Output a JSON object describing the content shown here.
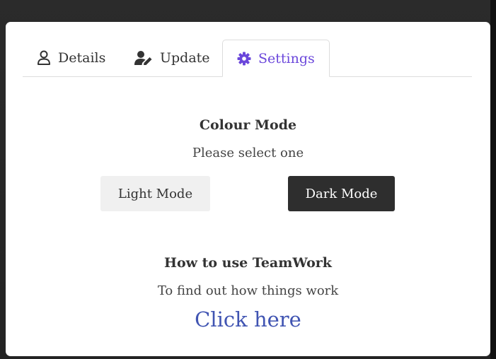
{
  "tabs": [
    {
      "label": "Details",
      "icon": "user-icon"
    },
    {
      "label": "Update",
      "icon": "user-edit-icon"
    },
    {
      "label": "Settings",
      "icon": "gear-icon",
      "active": true
    }
  ],
  "colour_mode": {
    "title": "Colour Mode",
    "subtitle": "Please select one",
    "light_label": "Light Mode",
    "dark_label": "Dark Mode"
  },
  "howto": {
    "title": "How to use TeamWork",
    "subtitle": "To find out how things work",
    "link_label": "Click here"
  },
  "colors": {
    "accent": "#6b47db",
    "link": "#4054b2",
    "dark_button": "#2e2e2e",
    "light_button": "#f0f0f0"
  }
}
